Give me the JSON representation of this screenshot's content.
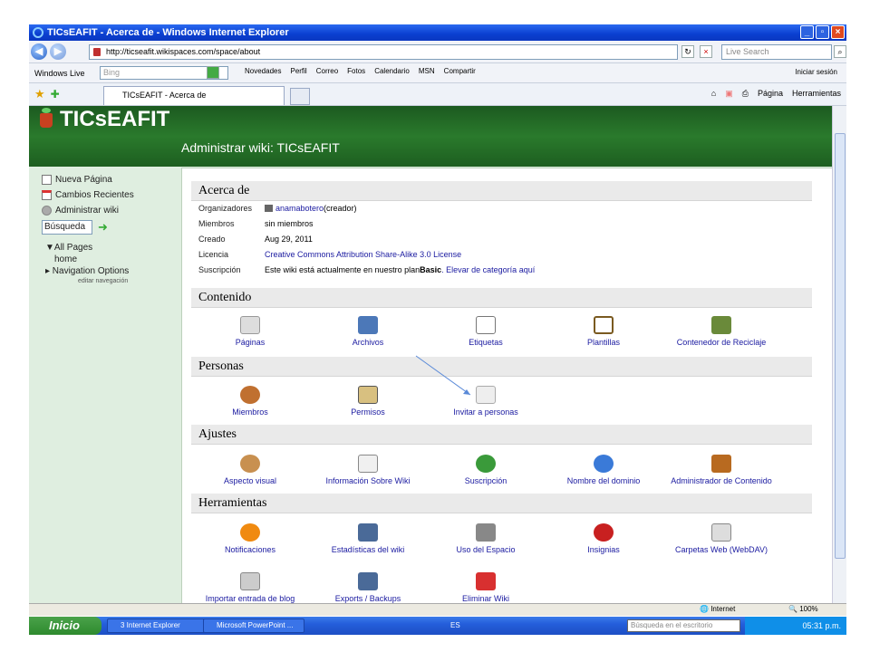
{
  "window": {
    "title": "TICsEAFIT - Acerca de - Windows Internet Explorer"
  },
  "address": {
    "url": "http://ticseafit.wikispaces.com/space/about",
    "search_placeholder": "Live Search"
  },
  "live_toolbar": {
    "brand": "Windows Live",
    "search_placeholder": "Bing",
    "links": [
      "Novedades",
      "Perfil",
      "Correo",
      "Fotos",
      "Calendario",
      "MSN",
      "Compartir"
    ],
    "signin": "Iniciar sesión"
  },
  "tabs": {
    "active": "TICsEAFIT - Acerca de",
    "tools": [
      "Página",
      "Herramientas"
    ]
  },
  "site": {
    "name": "TICsEAFIT",
    "subtitle": "Administrar wiki: TICsEAFIT"
  },
  "sidebar": {
    "items": [
      "Nueva Página",
      "Cambios Recientes",
      "Administrar wiki"
    ],
    "search_value": "Búsqueda",
    "tree": [
      "▼All Pages",
      "home",
      "▸ Navigation Options"
    ],
    "edit_nav": "editar navegación"
  },
  "about": {
    "heading": "Acerca de",
    "rows": [
      {
        "k": "Organizadores",
        "v": "anamabotero",
        "extra": " (creador)"
      },
      {
        "k": "Miembros",
        "v": "sin miembros"
      },
      {
        "k": "Creado",
        "v": "Aug 29, 2011"
      },
      {
        "k": "Licencia",
        "v": "Creative Commons Attribution Share-Alike 3.0 License"
      },
      {
        "k": "Suscripción",
        "v": "Este wiki está actualmente en nuestro plan ",
        "bold": "Basic",
        "link": ". Elevar de categoría aquí"
      }
    ]
  },
  "sections": {
    "contenido": {
      "heading": "Contenido",
      "tiles": [
        "Páginas",
        "Archivos",
        "Etiquetas",
        "Plantillas",
        "Contenedor de Reciclaje"
      ]
    },
    "personas": {
      "heading": "Personas",
      "tiles": [
        "Miembros",
        "Permisos",
        "Invitar a personas"
      ]
    },
    "ajustes": {
      "heading": "Ajustes",
      "tiles": [
        "Aspecto visual",
        "Información Sobre Wiki",
        "Suscripción",
        "Nombre del dominio",
        "Administrador de Contenido"
      ]
    },
    "herramientas": {
      "heading": "Herramientas",
      "tiles": [
        "Notificaciones",
        "Estadísticas del wiki",
        "Uso del Espacio",
        "Insignias",
        "Carpetas Web (WebDAV)",
        "Importar entrada de blog",
        "Exports / Backups",
        "Eliminar Wiki"
      ]
    }
  },
  "status": {
    "zone": "Internet",
    "zoom": "100%"
  },
  "taskbar": {
    "start": "Inicio",
    "tasks": [
      "3 Internet Explorer",
      "Microsoft PowerPoint ..."
    ],
    "lang": "ES",
    "desk_search": "Búsqueda en el escritorio",
    "clock": "05:31 p.m."
  }
}
